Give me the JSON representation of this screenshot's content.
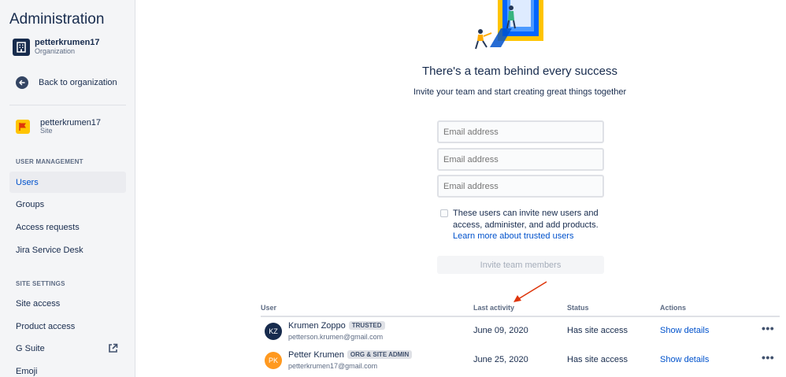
{
  "sidebar": {
    "title": "Administration",
    "org": {
      "name": "petterkrumen17",
      "sub": "Organization",
      "icon": "building-icon"
    },
    "back_label": "Back to organization",
    "site": {
      "name": "petterkrumen17",
      "sub": "Site",
      "icon": "flag-icon"
    },
    "sections": [
      {
        "label": "USER MANAGEMENT",
        "items": [
          "Users",
          "Groups",
          "Access requests",
          "Jira Service Desk"
        ]
      },
      {
        "label": "SITE SETTINGS",
        "items": [
          "Site access",
          "Product access",
          "G Suite",
          "Emoji"
        ]
      }
    ],
    "active_item": "Users"
  },
  "main": {
    "headline": "There's a team behind every success",
    "subline": "Invite your team and start creating great things together",
    "email_placeholder": "Email address",
    "trusted_checkbox_label": "These users can invite new users and access, administer, and add products.",
    "learn_more": "Learn more about trusted users",
    "invite_button": "Invite team members"
  },
  "table": {
    "headers": {
      "user": "User",
      "last_activity": "Last activity",
      "status": "Status",
      "actions": "Actions"
    },
    "rows": [
      {
        "initials": "KZ",
        "name": "Krumen Zoppo",
        "badge": "TRUSTED",
        "email": "petterson.krumen@gmail.com",
        "last_activity": "June 09, 2020",
        "status": "Has site access",
        "action": "Show details",
        "more": "•••",
        "avatar_color": "#172b4d"
      },
      {
        "initials": "PK",
        "name": "Petter Krumen",
        "badge": "ORG & SITE ADMIN",
        "email": "petterkrumen17@gmail.com",
        "last_activity": "June 25, 2020",
        "status": "Has site access",
        "action": "Show details",
        "more": "•••",
        "avatar_color": "#ff991f"
      }
    ]
  },
  "colors": {
    "accent": "#0052cc",
    "annotation_arrow": "#de350b"
  }
}
